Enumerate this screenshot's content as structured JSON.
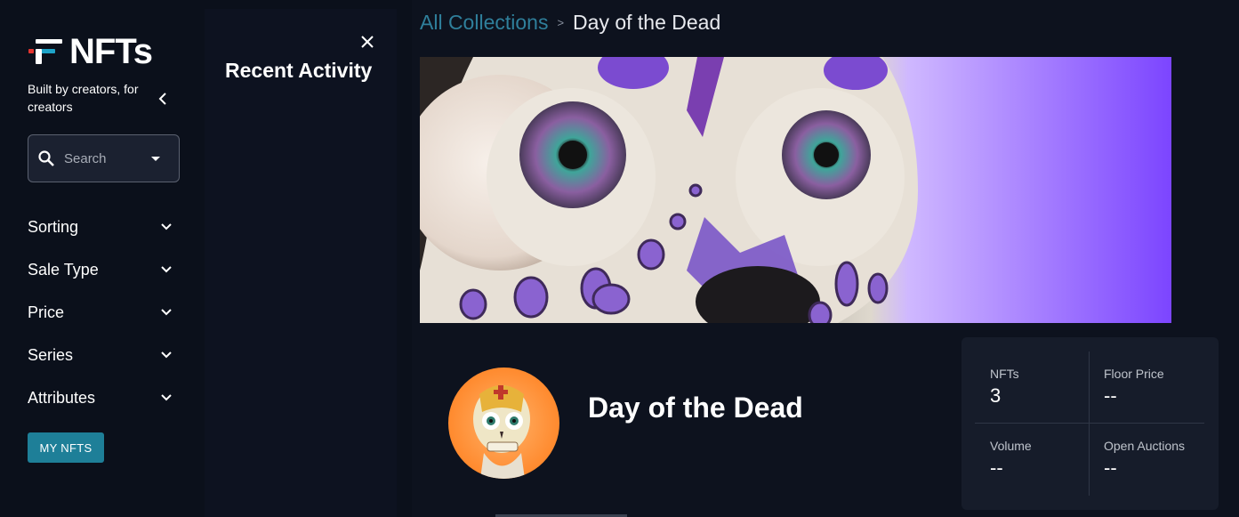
{
  "brand": {
    "logo_text": "NFTs",
    "tagline": "Built by creators, for creators",
    "colors": {
      "red": "#e3342f",
      "teal": "#1ea3c8",
      "white": "#ffffff"
    }
  },
  "sidebar": {
    "collapse_icon": "chevron-left-icon",
    "search": {
      "placeholder": "Search",
      "icon": "search-icon"
    },
    "filters": [
      {
        "label": "Sorting"
      },
      {
        "label": "Sale Type"
      },
      {
        "label": "Price"
      },
      {
        "label": "Series"
      },
      {
        "label": "Attributes"
      }
    ],
    "my_nfts_label": "MY NFTS"
  },
  "activity": {
    "title": "Recent Activity",
    "close_icon": "close-icon"
  },
  "breadcrumb": {
    "link": "All Collections",
    "separator": ">",
    "current": "Day of the Dead"
  },
  "collection": {
    "name": "Day of the Dead",
    "stats": [
      {
        "label": "NFTs",
        "value": "3"
      },
      {
        "label": "Floor Price",
        "value": "--"
      },
      {
        "label": "Volume",
        "value": "--"
      },
      {
        "label": "Open Auctions",
        "value": "--"
      }
    ]
  },
  "theme": {
    "accent": "#1e7f98",
    "link": "#2f7f9b",
    "banner_purple": "#7c45ff"
  }
}
